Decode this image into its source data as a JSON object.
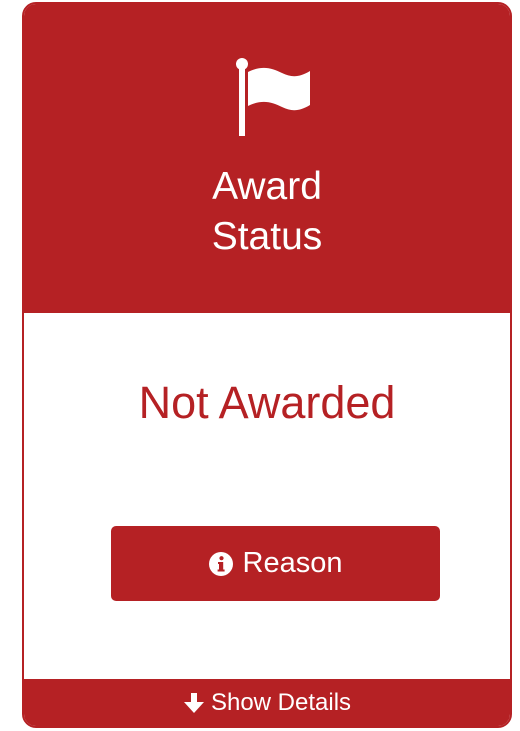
{
  "header": {
    "icon": "flag-icon",
    "title_line1": "Award",
    "title_line2": "Status"
  },
  "body": {
    "status": "Not Awarded",
    "reason_button": {
      "icon": "info-circle-icon",
      "label": "Reason"
    }
  },
  "footer": {
    "icon": "arrow-down-icon",
    "label": "Show Details"
  },
  "colors": {
    "accent": "#b52124",
    "background": "#ffffff",
    "text_on_accent": "#ffffff"
  }
}
